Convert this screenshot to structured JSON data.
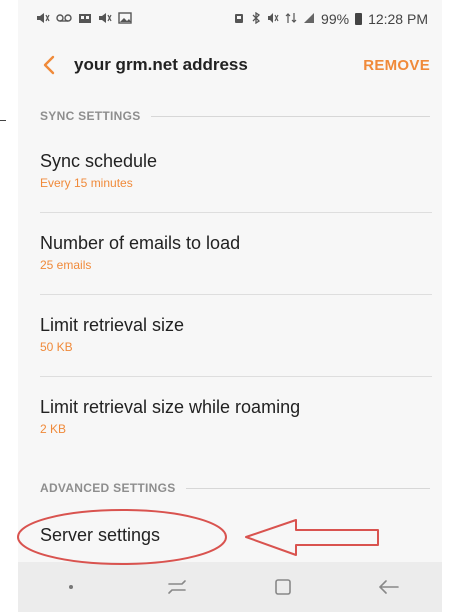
{
  "statusbar": {
    "battery": "99%",
    "time": "12:28 PM"
  },
  "header": {
    "title": "your grm.net address",
    "remove_label": "REMOVE"
  },
  "sync_section": {
    "label": "SYNC SETTINGS",
    "items": [
      {
        "title": "Sync schedule",
        "subtitle": "Every 15 minutes"
      },
      {
        "title": "Number of emails to load",
        "subtitle": "25 emails"
      },
      {
        "title": "Limit retrieval size",
        "subtitle": "50 KB"
      },
      {
        "title": "Limit retrieval size while roaming",
        "subtitle": "2 KB"
      }
    ]
  },
  "advanced_section": {
    "label": "ADVANCED SETTINGS",
    "items": [
      {
        "title": "Server settings"
      }
    ]
  },
  "colors": {
    "accent": "#f08a3a",
    "annotation": "#d9534f"
  },
  "icons": [
    "voicemail-icon",
    "vibrate-icon",
    "bluetooth-icon",
    "mute-icon",
    "signal-icon",
    "battery-icon",
    "back-arrow-icon",
    "recent-apps-icon",
    "home-icon",
    "nav-back-icon"
  ]
}
